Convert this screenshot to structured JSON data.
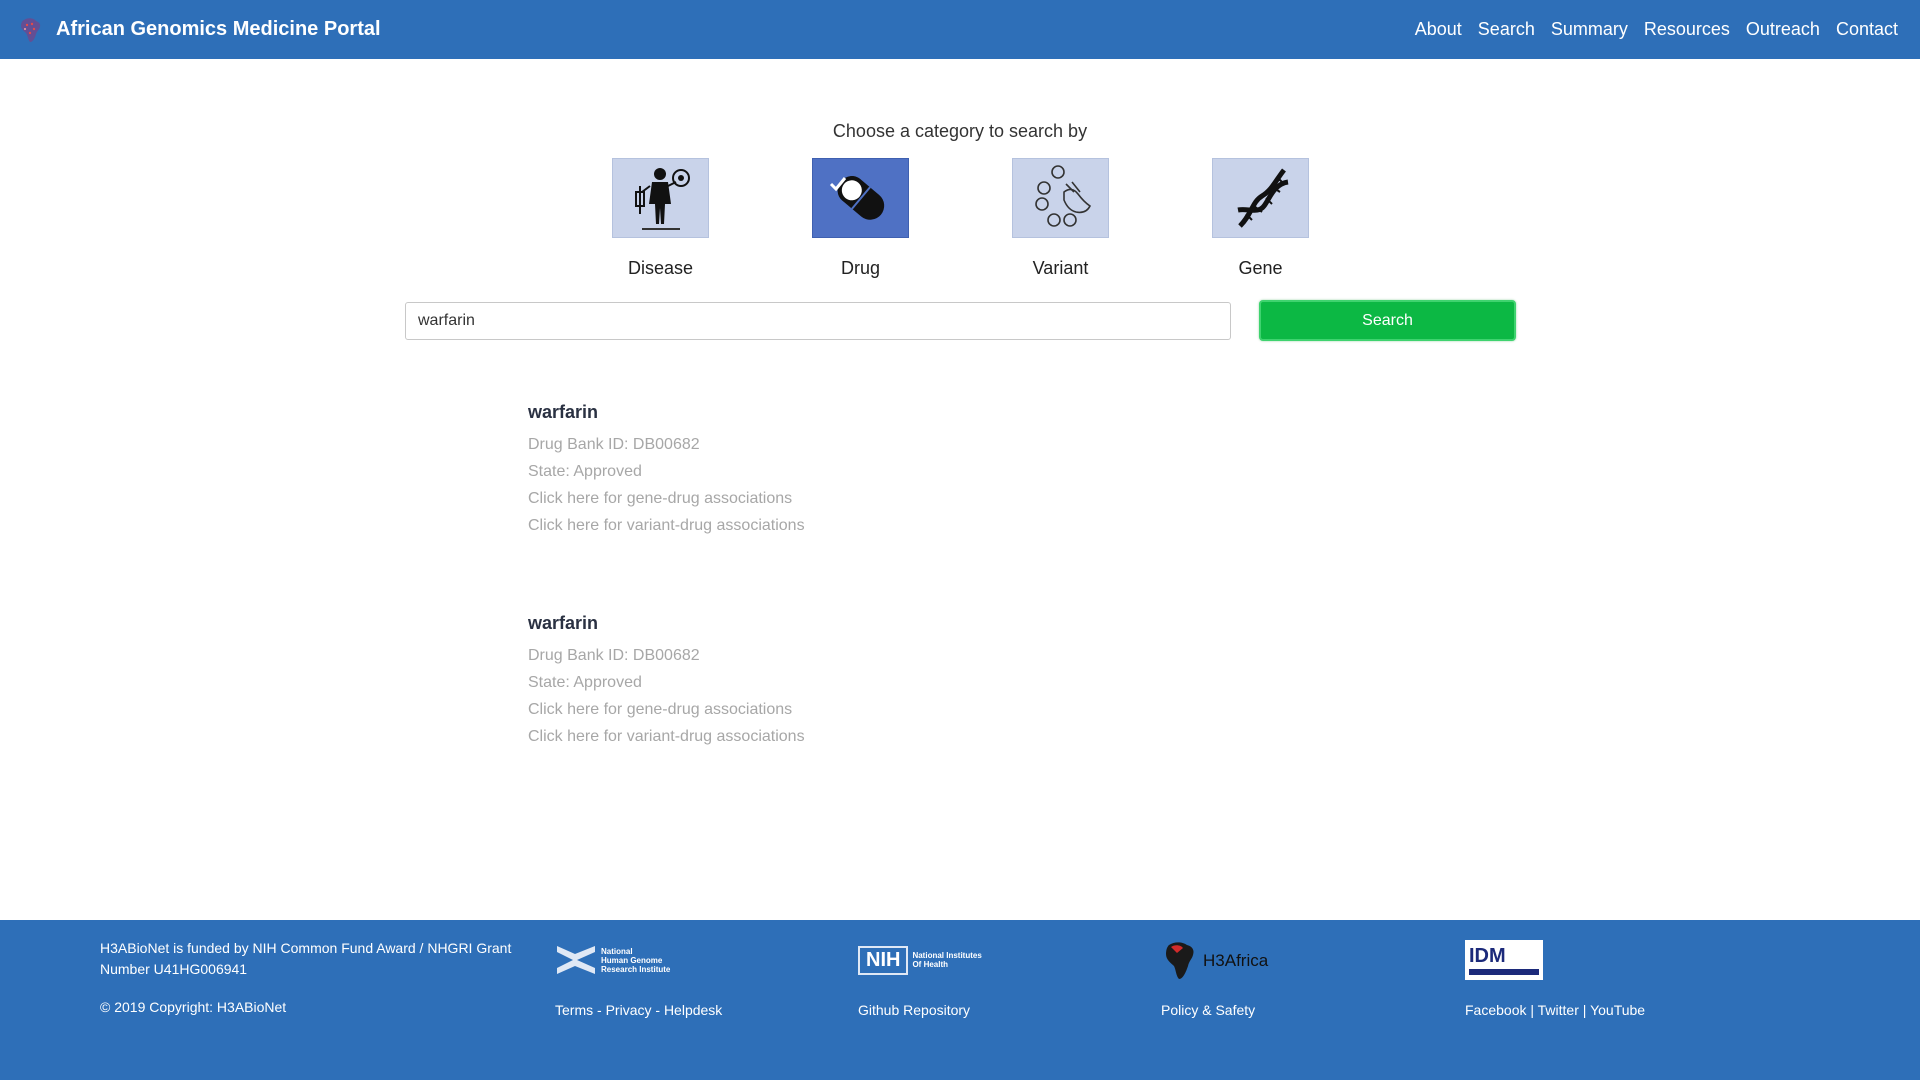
{
  "app": {
    "title": "African Genomics Medicine Portal"
  },
  "nav": {
    "items": [
      "About",
      "Search",
      "Summary",
      "Resources",
      "Outreach",
      "Contact"
    ]
  },
  "search": {
    "prompt": "Choose a category to search by",
    "categories": [
      {
        "label": "Disease",
        "icon": "disease-icon",
        "selected": false
      },
      {
        "label": "Drug",
        "icon": "pill-icon",
        "selected": true
      },
      {
        "label": "Variant",
        "icon": "variant-icon",
        "selected": false
      },
      {
        "label": "Gene",
        "icon": "dna-icon",
        "selected": false
      }
    ],
    "query": "warfarin",
    "button_label": "Search"
  },
  "results": [
    {
      "name": "warfarin",
      "drugbank": "Drug Bank ID: DB00682",
      "state": "State: Approved",
      "gene_link": "Click here for gene-drug associations",
      "variant_link": "Click here for variant-drug associations"
    },
    {
      "name": "warfarin",
      "drugbank": "Drug Bank ID: DB00682",
      "state": "State: Approved",
      "gene_link": "Click here for gene-drug associations",
      "variant_link": "Click here for variant-drug associations"
    }
  ],
  "footer": {
    "funding": "H3ABioNet is funded by NIH Common Fund Award / NHGRI Grant Number U41HG006941",
    "copyright": "© 2019 Copyright: H3ABioNet",
    "nhgri_logo_text": [
      "National",
      "Human Genome",
      "Research Institute"
    ],
    "nih_logo_text": [
      "NIH",
      "National Institutes",
      "Of Health"
    ],
    "h3africa_logo_text": "H3Africa",
    "idm_logo_text": "IDM",
    "links_col1": [
      "Terms",
      "Privacy",
      "Helpdesk"
    ],
    "links_col2": "Github Repository",
    "links_col3": "Policy & Safety",
    "links_col4": [
      "Facebook",
      "Twitter",
      "YouTube"
    ],
    "sep_dash": " - ",
    "sep_pipe": " | ",
    "colors": {
      "bar": "#2e6fb8",
      "search_button": "#0cb844"
    }
  }
}
